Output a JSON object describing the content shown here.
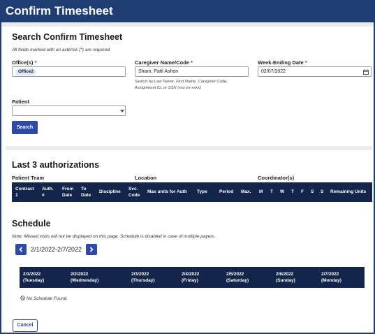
{
  "page": {
    "title": "Confirm Timesheet"
  },
  "search": {
    "heading": "Search Confirm Timesheet",
    "required_note": "All fields marked with an asterisk (*) are required.",
    "asterisk": "*",
    "office_label": "Office(s)",
    "office_chip": "Office2",
    "caregiver_label": "Caregiver Name/Code",
    "caregiver_value": "Sham, Patil Ashon",
    "caregiver_hint_1": "Search by Last Name, First Name, Caregiver Code,",
    "caregiver_hint_2": "Assignment ID, or SSN (xxx-xx-xxxx)",
    "week_label": "Week-Ending Date",
    "week_value": "02/07/2022",
    "patient_label": "Patient",
    "patient_value": "",
    "search_button": "Search"
  },
  "authorizations": {
    "heading": "Last 3 authorizations",
    "group_patient_team": "Patient Team",
    "group_location": "Location",
    "group_coordinator": "Coordinator(s)",
    "columns": [
      [
        "Contract",
        "1"
      ],
      [
        "Auth.",
        "#"
      ],
      [
        "From",
        "Date"
      ],
      [
        "To",
        "Date"
      ],
      [
        "Discipline"
      ],
      [
        "Svc.",
        "Code"
      ],
      [
        "Max units for Auth"
      ],
      [
        "Type"
      ],
      [
        "Period"
      ],
      [
        "Max."
      ],
      [
        "M"
      ],
      [
        "T"
      ],
      [
        "W"
      ],
      [
        "T"
      ],
      [
        "F"
      ],
      [
        "S"
      ],
      [
        "S"
      ],
      [
        "Remaining Units"
      ]
    ]
  },
  "schedule": {
    "heading": "Schedule",
    "note": "Note: Missed visits will not be displayed on this page. Schedule is disabled in case of multiple payers.",
    "range": "2/1/2022-2/7/2022",
    "prev_icon": "chevron-left-icon",
    "next_icon": "chevron-right-icon",
    "days": [
      [
        "2/1/2022",
        "(Tuesday)"
      ],
      [
        "2/2/2022",
        "(Wednesday)"
      ],
      [
        "2/3/2022",
        "(Thursday)"
      ],
      [
        "2/4/2022",
        "(Friday)"
      ],
      [
        "2/5/2022",
        "(Saturday)"
      ],
      [
        "2/6/2022",
        "(Sunday)"
      ],
      [
        "2/7/2022",
        "(Monday)"
      ]
    ],
    "empty_text": "No Schedule Found."
  },
  "footer": {
    "cancel_button": "Cancel"
  },
  "colors": {
    "brand": "#1f3c73",
    "button": "#2f49a8",
    "table_header": "#13254a",
    "required": "#c8102e"
  }
}
